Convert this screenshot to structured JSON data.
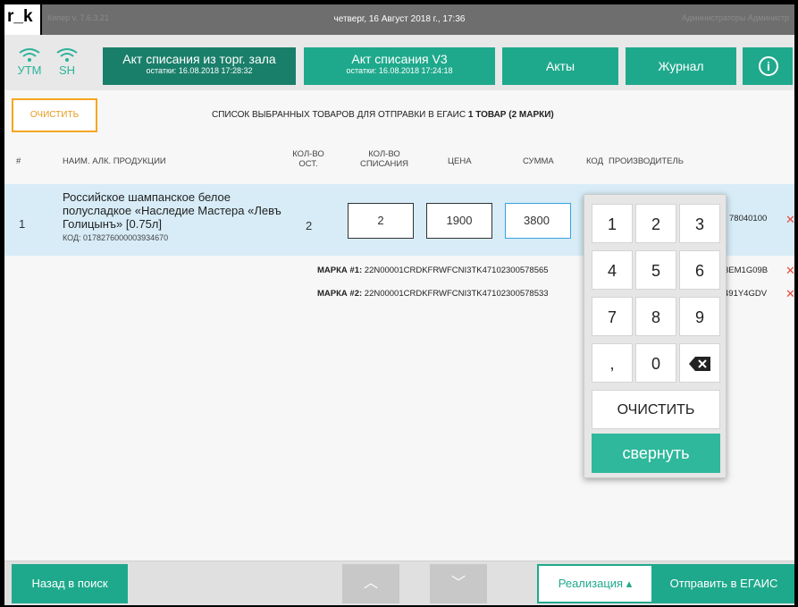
{
  "topbar": {
    "logo": "r_k",
    "version": "Кипер v. 7.6.3.21",
    "datetime": "четверг, 16 Август 2018 г., 17:36",
    "users": "Администраторы Администр"
  },
  "status": [
    {
      "label": "УТМ",
      "icon": "wifi-icon"
    },
    {
      "label": "SH",
      "icon": "wifi-icon"
    }
  ],
  "header": {
    "btn1": {
      "title": "Акт списания из торг. зала",
      "sub": "остатки: 16.08.2018 17:28:32"
    },
    "btn2": {
      "title": "Акт списания V3",
      "sub": "остатки: 16.08.2018 17:24:18"
    },
    "acts": "Акты",
    "journal": "Журнал",
    "info_icon": "i"
  },
  "toolbar": {
    "clear": "ОЧИСТИТЬ",
    "list_title": "СПИСОК ВЫБРАННЫХ ТОВАРОВ ДЛЯ ОТПРАВКИ В ЕГАИС",
    "count": "1 ТОВАР  (2 МАРКИ)"
  },
  "columns": {
    "num": "#",
    "name": "НАИМ. АЛК. ПРОДУКЦИИ",
    "ost1": "КОЛ-ВО",
    "ost2": "ОСТ.",
    "wo1": "КОЛ-ВО",
    "wo2": "СПИСАНИЯ",
    "price": "ЦЕНА",
    "sum": "СУММА",
    "code": "КОД",
    "producer": "ПРОИЗВОДИТЕЛЬ"
  },
  "row": {
    "num": "1",
    "name": "Российское шампанское белое полусладкое «Наследие Мастера «Левъ Голицынъ» [0.75л]",
    "code": "КОД: 0178276000003934670",
    "ost": "2",
    "qty": "2",
    "price": "1900",
    "sum": "3800",
    "trail": "78040100",
    "delete": "✕"
  },
  "marks": [
    {
      "label": "МАРКА #1:",
      "code": "22N00001CRDKFRWFCNI3TK47102300578565",
      "tail": "3EM1G09B",
      "delete": "✕"
    },
    {
      "label": "МАРКА #2:",
      "code": "22N00001CRDKFRWFCNI3TK47102300578533",
      "tail": "491Y4GDV",
      "delete": "✕"
    }
  ],
  "keypad": {
    "keys": [
      "1",
      "2",
      "3",
      "4",
      "5",
      "6",
      "7",
      "8",
      "9",
      ",",
      "0"
    ],
    "backspace_icon": "backspace-icon",
    "clear": "ОЧИСТИТЬ",
    "collapse": "свернуть"
  },
  "footer": {
    "back": "Назад в поиск",
    "up": "︿",
    "down": "﹀",
    "sale": "Реализация ▴",
    "send": "Отправить в ЕГАИС"
  },
  "colors": {
    "accent": "#1fa98c",
    "accent_dark": "#1a7f6a",
    "orange": "#f5a623",
    "delete": "#e74c3c",
    "row_selected": "#d7ecf7"
  }
}
